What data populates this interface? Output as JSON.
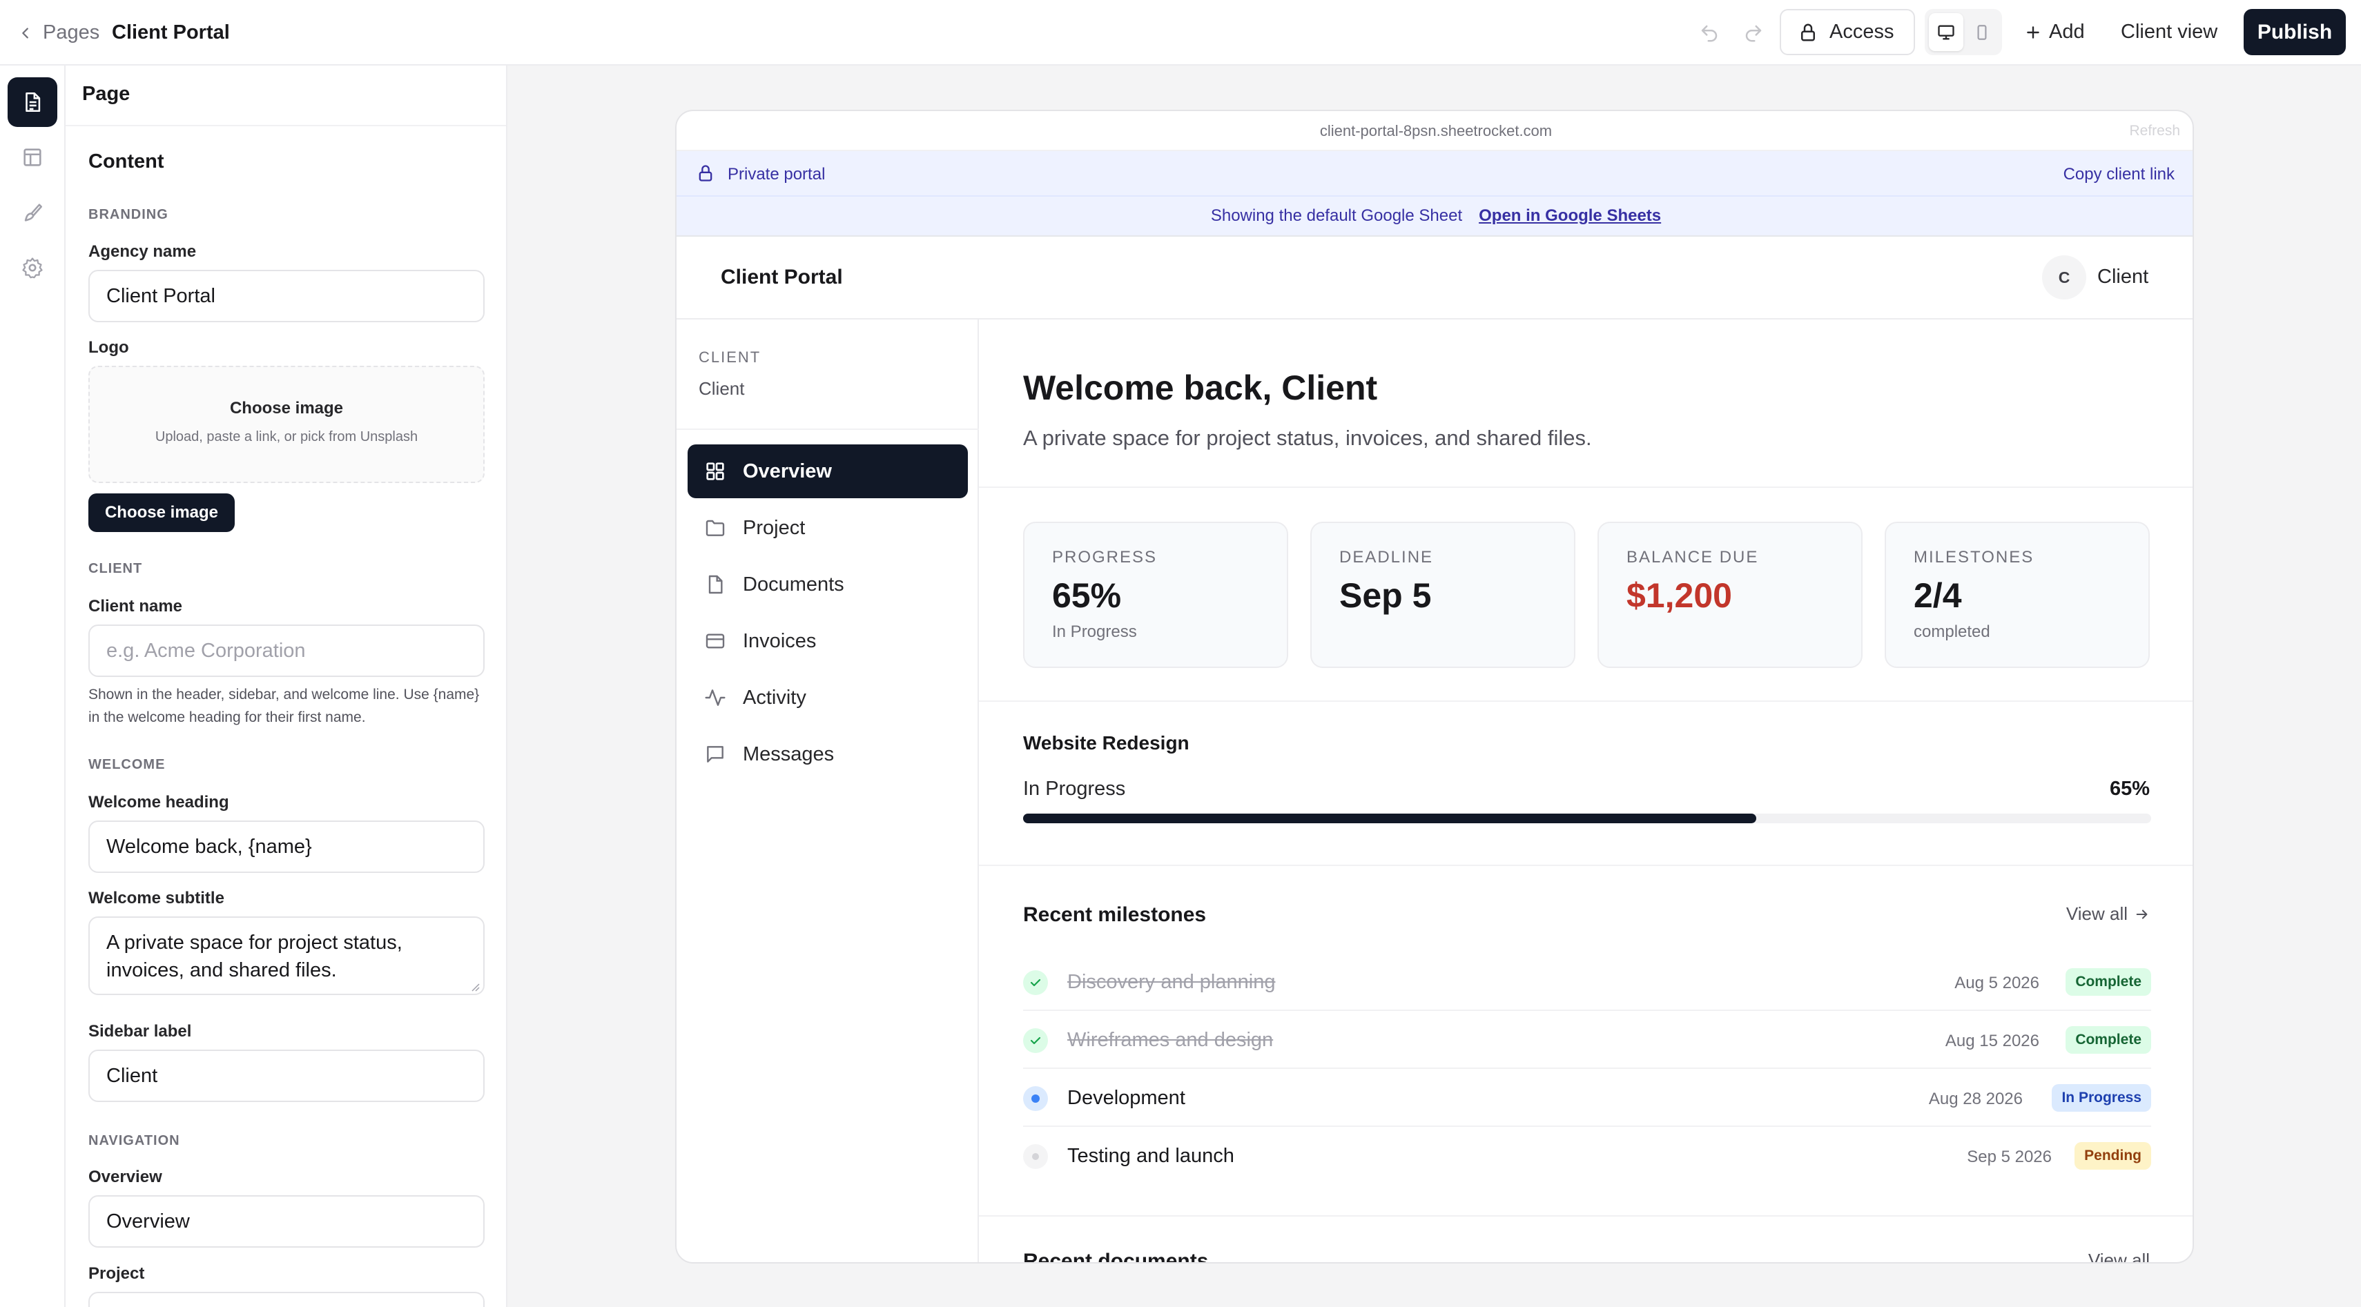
{
  "topbar": {
    "back_label": "Pages",
    "page_title": "Client Portal",
    "access_label": "Access",
    "add_label": "Add",
    "client_view_label": "Client view",
    "publish_label": "Publish"
  },
  "panel": {
    "header": "Page",
    "section_title": "Content",
    "branding_label": "BRANDING",
    "agency_name_label": "Agency name",
    "agency_name_value": "Client Portal",
    "logo_label": "Logo",
    "logo_drop_title": "Choose image",
    "logo_drop_hint": "Upload, paste a link, or pick from Unsplash",
    "logo_button": "Choose image",
    "client_section": "CLIENT",
    "client_name_label": "Client name",
    "client_name_placeholder": "e.g. Acme Corporation",
    "client_name_help": "Shown in the header, sidebar, and welcome line. Use {name} in the welcome heading for their first name.",
    "welcome_section": "WELCOME",
    "welcome_heading_label": "Welcome heading",
    "welcome_heading_value": "Welcome back, {name}",
    "welcome_subtitle_label": "Welcome subtitle",
    "welcome_subtitle_value": "A private space for project status, invoices, and shared files.",
    "sidebar_label_label": "Sidebar label",
    "sidebar_label_value": "Client",
    "navigation_section": "NAVIGATION",
    "overview_label": "Overview",
    "overview_value": "Overview",
    "project_label": "Project"
  },
  "preview": {
    "url": "client-portal-8psn.sheetrocket.com",
    "refresh_label": "Refresh",
    "private_label": "Private portal",
    "copy_link_label": "Copy client link",
    "sheet_notice": "Showing the default Google Sheet",
    "sheet_link": "Open in Google Sheets",
    "brand": "Client Portal",
    "avatar_initial": "C",
    "user_name": "Client",
    "sidebar_caption": "CLIENT",
    "sidebar_client": "Client",
    "nav": [
      {
        "label": "Overview",
        "icon": "grid-icon"
      },
      {
        "label": "Project",
        "icon": "folder-icon"
      },
      {
        "label": "Documents",
        "icon": "file-icon"
      },
      {
        "label": "Invoices",
        "icon": "credit-card-icon"
      },
      {
        "label": "Activity",
        "icon": "activity-icon"
      },
      {
        "label": "Messages",
        "icon": "message-icon"
      }
    ],
    "welcome_title": "Welcome back, Client",
    "welcome_sub": "A private space for project status, invoices, and shared files.",
    "stats": [
      {
        "key": "PROGRESS",
        "value": "65%",
        "sub": "In Progress"
      },
      {
        "key": "DEADLINE",
        "value": "Sep 5",
        "sub": ""
      },
      {
        "key": "BALANCE DUE",
        "value": "$1,200",
        "sub": "",
        "color": "#c2362b"
      },
      {
        "key": "MILESTONES",
        "value": "2/4",
        "sub": "completed"
      }
    ],
    "project": {
      "name": "Website Redesign",
      "status": "In Progress",
      "percent_label": "65%",
      "progress": 0.65
    },
    "milestones_title": "Recent milestones",
    "view_all": "View all",
    "milestones": [
      {
        "name": "Discovery and planning",
        "date": "Aug 5 2026",
        "status": "Complete",
        "state": "done"
      },
      {
        "name": "Wireframes and design",
        "date": "Aug 15 2026",
        "status": "Complete",
        "state": "done"
      },
      {
        "name": "Development",
        "date": "Aug 28 2026",
        "status": "In Progress",
        "state": "active"
      },
      {
        "name": "Testing and launch",
        "date": "Sep 5 2026",
        "status": "Pending",
        "state": "pending"
      }
    ],
    "documents_title": "Recent documents",
    "documents_view_all": "View all"
  },
  "colors": {
    "accent_dark": "#111827",
    "balance_red": "#c2362b",
    "complete_bg": "#dcfce7",
    "complete_fg": "#166534",
    "progress_bg": "#dbeafe",
    "progress_fg": "#1e40af",
    "pending_bg": "#fef3c7",
    "pending_fg": "#92400e",
    "banner_bg": "#eef2ff"
  }
}
